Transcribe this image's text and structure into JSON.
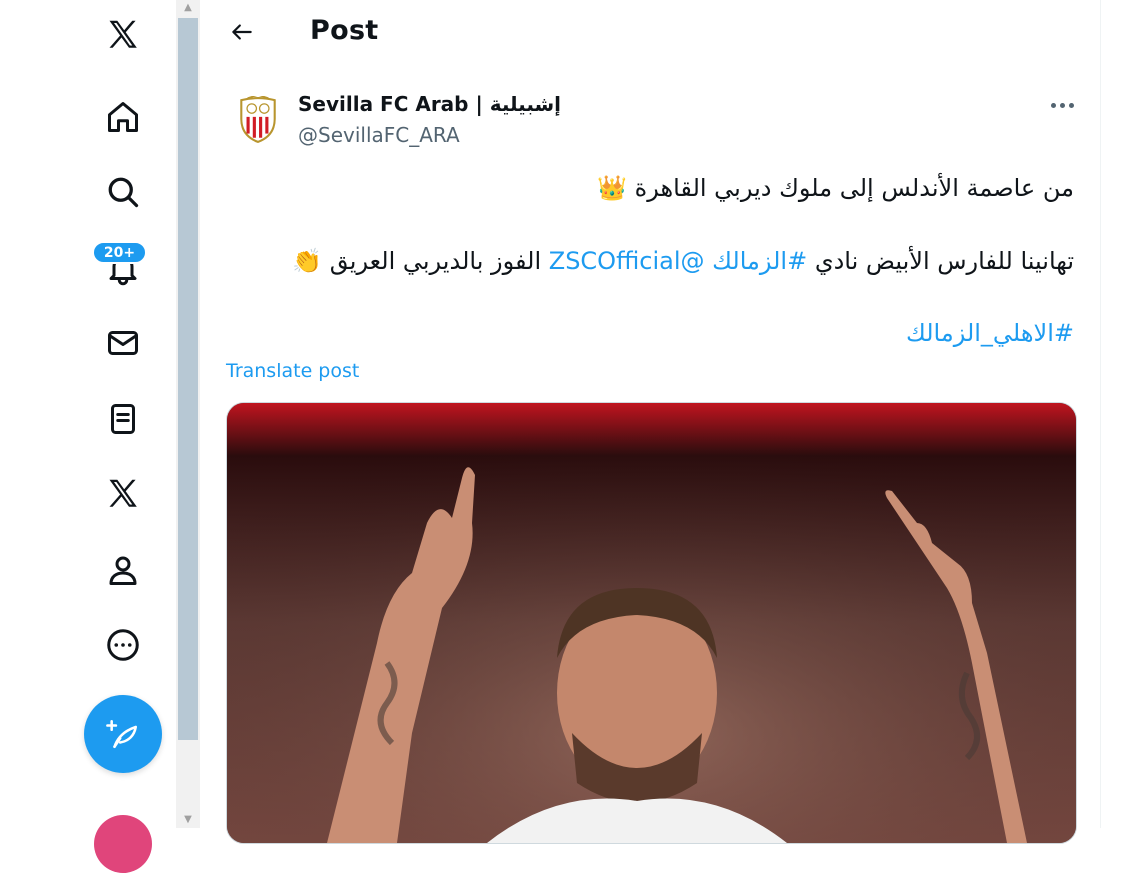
{
  "header": {
    "title": "Post"
  },
  "nav": {
    "notifications_badge": "20+",
    "items": [
      "x-logo",
      "home",
      "explore",
      "notifications",
      "messages",
      "lists",
      "premium",
      "profile",
      "more"
    ]
  },
  "post": {
    "author_name": "Sevilla FC Arab | إشبيلية",
    "author_handle": "@SevillaFC_ARA",
    "line1": "من عاصمة الأندلس إلى ملوك ديربي القاهرة 👑",
    "line2_prefix": "تهانينا للفارس الأبيض نادي ",
    "line2_hashtag": "#الزمالك",
    "line2_mention": "@ZSCOfficial",
    "line2_suffix": " الفوز بالديربي العريق 👏",
    "line3_hashtag": "#الاهلي_الزمالك",
    "translate_label": "Translate post"
  },
  "colors": {
    "accent": "#1d9bf0",
    "text": "#0f1419",
    "muted": "#536471"
  }
}
